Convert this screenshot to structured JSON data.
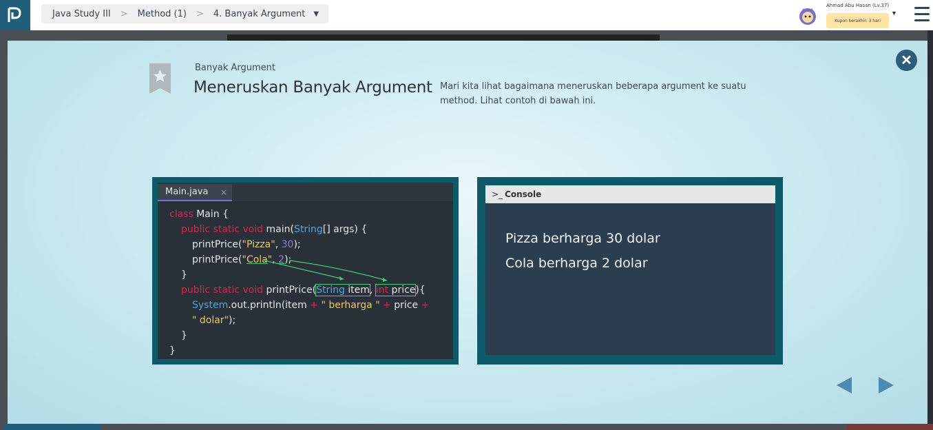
{
  "breadcrumb": {
    "course": "Java Study III",
    "chapter": "Method (1)",
    "lesson": "4. Banyak Argument"
  },
  "user": {
    "name": "Ahmad Abu Hasan (Lv.37)",
    "coupon": "Kupon berakhir: 3 hari"
  },
  "slide": {
    "subtitle": "Banyak Argument",
    "title": "Meneruskan Banyak Argument",
    "description": "Mari kita lihat bagaimana meneruskan beberapa argument ke suatu method. Lihat contoh di bawah ini."
  },
  "editor": {
    "tab_label": "Main.java",
    "tab_close": "×"
  },
  "console": {
    "title": "Console",
    "icon": ">_",
    "lines": [
      "Pizza berharga 30 dolar",
      "Cola berharga 2 dolar"
    ]
  },
  "icons": {
    "close": "close-circle-icon",
    "prev": "triangle-left-icon",
    "next": "triangle-right-icon",
    "bookmark": "star-bookmark-icon"
  },
  "colors": {
    "keyword": "#d6264f",
    "type": "#4fa6e0",
    "string": "#e7c96a",
    "number": "#8f7fd9",
    "highlight": "#3fcf7a",
    "accent": "#0f5a68"
  }
}
